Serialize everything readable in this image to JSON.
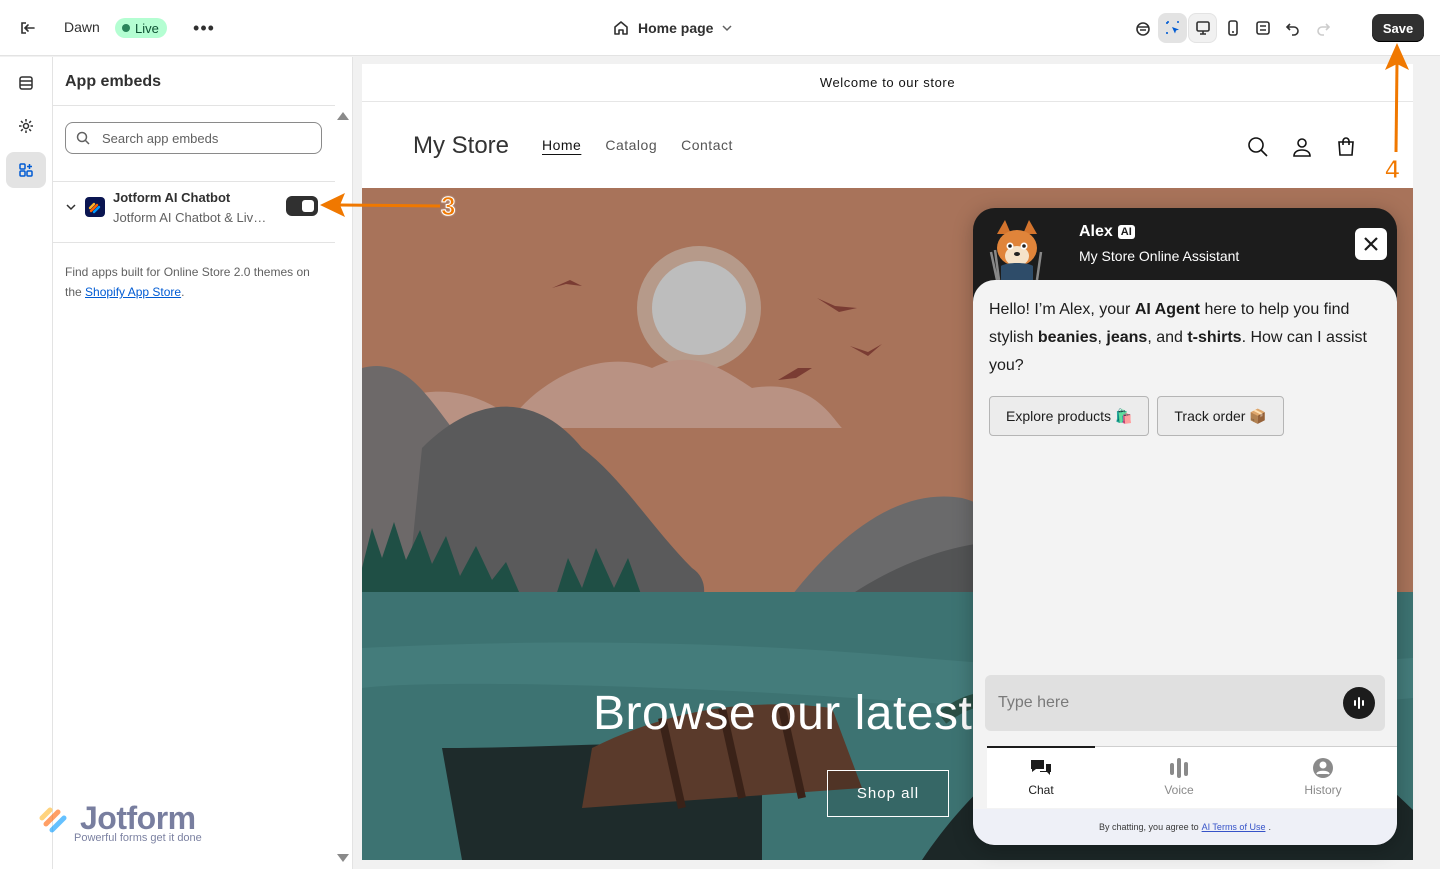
{
  "topbar": {
    "theme_name": "Dawn",
    "live_label": "Live",
    "more_label": "•••",
    "page_selector": "Home page",
    "save_label": "Save"
  },
  "panel": {
    "title": "App embeds",
    "search_placeholder": "Search app embeds",
    "app": {
      "name": "Jotform AI Chatbot",
      "subtitle": "Jotform AI Chatbot & Live Chat",
      "enabled": true
    },
    "find_text_1": "Find apps built for Online Store 2.0 themes on the ",
    "find_link": "Shopify App Store",
    "find_text_2": "."
  },
  "brand": {
    "word": "Jotform",
    "tagline": "Powerful forms get it done"
  },
  "store": {
    "announcement": "Welcome to our store",
    "logo": "My Store",
    "nav": [
      "Home",
      "Catalog",
      "Contact"
    ],
    "hero_title": "Browse our latest",
    "hero_button": "Shop all"
  },
  "chat": {
    "agent_name": "Alex",
    "agent_badge": "AI",
    "agent_role": "My Store Online Assistant",
    "msg_1": "Hello! I’m Alex, your ",
    "msg_b1": "AI Agent",
    "msg_2": " here to help you find stylish ",
    "msg_b2": "beanies",
    "msg_3": ", ",
    "msg_b3": "jeans",
    "msg_4": ", and ",
    "msg_b4": "t-shirts",
    "msg_5": ". How can I assist you?",
    "chip_1": "Explore products 🛍️",
    "chip_2": "Track order 📦",
    "input_placeholder": "Type here",
    "tabs": [
      "Chat",
      "Voice",
      "History"
    ],
    "footer_text": "By chatting, you agree to",
    "footer_link": "AI Terms of Use",
    "footer_end": "."
  },
  "annotations": [
    "3",
    "4"
  ],
  "colors": {
    "annotation": "#f07800",
    "live_badge_bg": "#b4fed2",
    "save_bg": "#303030",
    "link": "#005bd3"
  }
}
